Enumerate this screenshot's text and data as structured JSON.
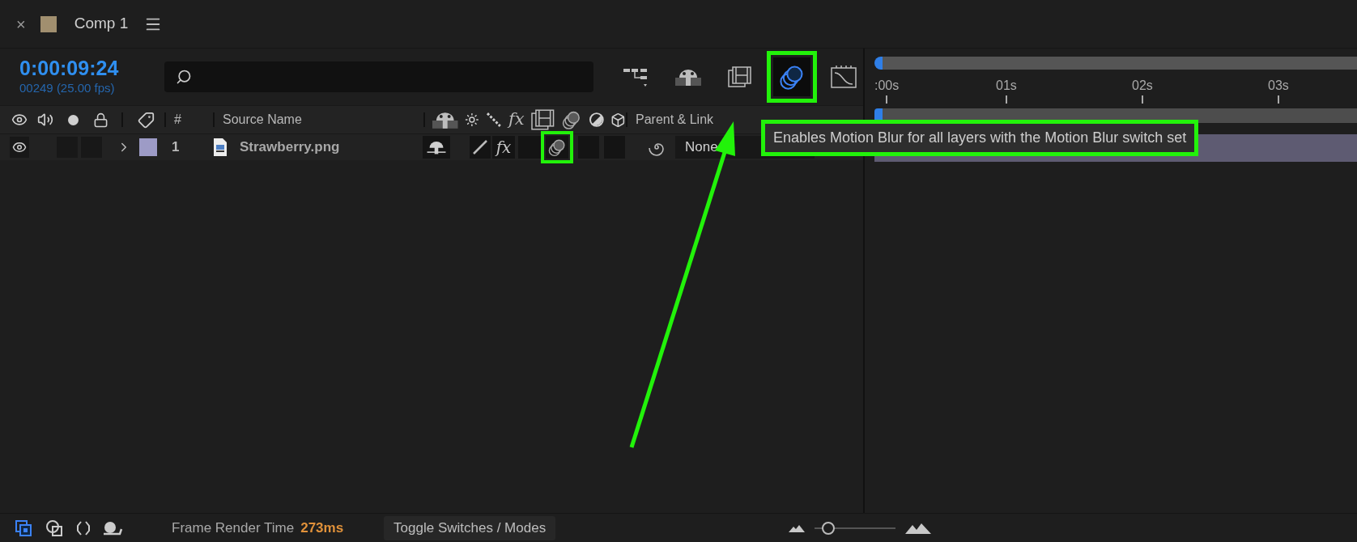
{
  "panel": {
    "close": "×",
    "title": "Comp 1"
  },
  "timecode": "0:00:09:24",
  "frame_info": "00249 (25.00 fps)",
  "toolbar": [
    {
      "kind": "flowchart",
      "active": false
    },
    {
      "kind": "draft3d",
      "active": false
    },
    {
      "kind": "frameblend",
      "active": false
    },
    {
      "kind": "motionblur",
      "active": true
    },
    {
      "kind": "graph",
      "active": false
    }
  ],
  "columns": {
    "number": "#",
    "source_name": "Source Name",
    "fx": "fx",
    "parent": "Parent & Link"
  },
  "layers": [
    {
      "number": "1",
      "name": "Strawberry.png",
      "color": "#9d9bc6",
      "visible": true,
      "shy": true,
      "quality": true,
      "fx": "fx",
      "effects": true,
      "frame_blend": false,
      "motion_blur": true,
      "adjustment": false,
      "three_d": false,
      "parent": "None"
    }
  ],
  "ruler": [
    ":00s",
    "01s",
    "02s",
    "03s"
  ],
  "tooltip": "Enables Motion Blur for all layers with the Motion Blur switch set",
  "footer": {
    "render_label": "Frame Render Time",
    "render_value": "273ms",
    "toggle": "Toggle Switches / Modes",
    "zoom": {
      "level": 0.1
    }
  }
}
